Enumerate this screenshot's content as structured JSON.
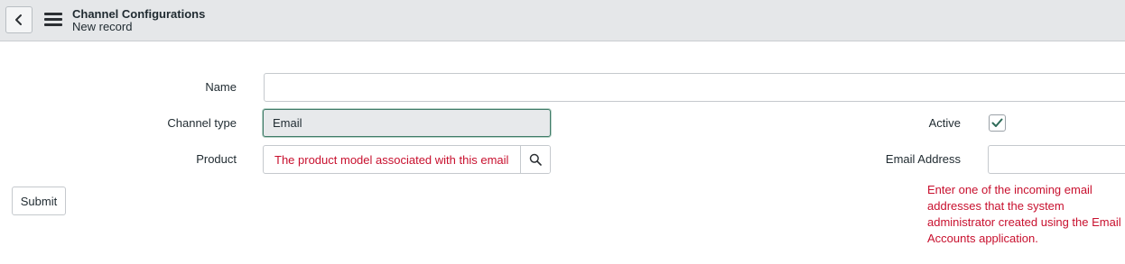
{
  "header": {
    "title": "Channel Configurations",
    "subtitle": "New record"
  },
  "form": {
    "name": {
      "label": "Name",
      "value": ""
    },
    "channel_type": {
      "label": "Channel type",
      "value": "Email"
    },
    "product": {
      "label": "Product",
      "hint": "The product model associated with this email"
    },
    "active": {
      "label": "Active",
      "checked": true
    },
    "email_address": {
      "label": "Email Address",
      "value": ""
    },
    "email_help": "Enter one of the incoming email addresses that the system administrator created using the Email Accounts application.",
    "submit_label": "Submit"
  },
  "icons": {
    "back": "chevron-left-icon",
    "menu": "hamburger-menu-icon",
    "search": "search-icon",
    "check": "checkmark-icon"
  },
  "colors": {
    "header_bg": "#e5e7e9",
    "field_focus_border": "#3f7b68",
    "hint_red": "#c8102e",
    "check_green": "#2e6b58"
  }
}
